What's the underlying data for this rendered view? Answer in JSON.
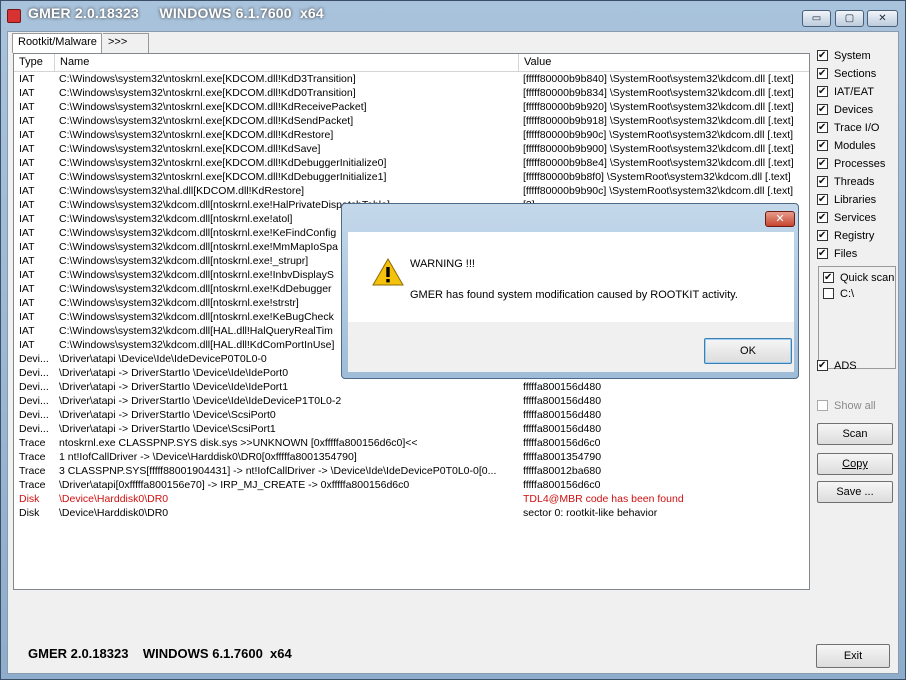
{
  "window": {
    "title": "GMER 2.0.18323     WINDOWS 6.1.7600  x64",
    "min_symbol": "▭",
    "max_symbol": "▢",
    "close_symbol": "✕"
  },
  "tabs": [
    {
      "label": "Rootkit/Malware"
    },
    {
      "label": ">>>"
    }
  ],
  "table": {
    "columns": [
      "Type",
      "Name",
      "Value"
    ],
    "rows": [
      {
        "type": "IAT",
        "name": "C:\\Windows\\system32\\ntoskrnl.exe[KDCOM.dll!KdD3Transition]",
        "value": "[fffff80000b9b840] \\SystemRoot\\system32\\kdcom.dll [.text]"
      },
      {
        "type": "IAT",
        "name": "C:\\Windows\\system32\\ntoskrnl.exe[KDCOM.dll!KdD0Transition]",
        "value": "[fffff80000b9b834] \\SystemRoot\\system32\\kdcom.dll [.text]"
      },
      {
        "type": "IAT",
        "name": "C:\\Windows\\system32\\ntoskrnl.exe[KDCOM.dll!KdReceivePacket]",
        "value": "[fffff80000b9b920] \\SystemRoot\\system32\\kdcom.dll [.text]"
      },
      {
        "type": "IAT",
        "name": "C:\\Windows\\system32\\ntoskrnl.exe[KDCOM.dll!KdSendPacket]",
        "value": "[fffff80000b9b918] \\SystemRoot\\system32\\kdcom.dll [.text]"
      },
      {
        "type": "IAT",
        "name": "C:\\Windows\\system32\\ntoskrnl.exe[KDCOM.dll!KdRestore]",
        "value": "[fffff80000b9b90c] \\SystemRoot\\system32\\kdcom.dll [.text]"
      },
      {
        "type": "IAT",
        "name": "C:\\Windows\\system32\\ntoskrnl.exe[KDCOM.dll!KdSave]",
        "value": "[fffff80000b9b900] \\SystemRoot\\system32\\kdcom.dll [.text]"
      },
      {
        "type": "IAT",
        "name": "C:\\Windows\\system32\\ntoskrnl.exe[KDCOM.dll!KdDebuggerInitialize0]",
        "value": "[fffff80000b9b8e4] \\SystemRoot\\system32\\kdcom.dll [.text]"
      },
      {
        "type": "IAT",
        "name": "C:\\Windows\\system32\\ntoskrnl.exe[KDCOM.dll!KdDebuggerInitialize1]",
        "value": "[fffff80000b9b8f0] \\SystemRoot\\system32\\kdcom.dll [.text]"
      },
      {
        "type": "IAT",
        "name": "C:\\Windows\\system32\\hal.dll[KDCOM.dll!KdRestore]",
        "value": "[fffff80000b9b90c] \\SystemRoot\\system32\\kdcom.dll [.text]"
      },
      {
        "type": "IAT",
        "name": "C:\\Windows\\system32\\kdcom.dll[ntoskrnl.exe!HalPrivateDispatchTable]",
        "value": "[3]"
      },
      {
        "type": "IAT",
        "name": "C:\\Windows\\system32\\kdcom.dll[ntoskrnl.exe!atol]",
        "value": ""
      },
      {
        "type": "IAT",
        "name": "C:\\Windows\\system32\\kdcom.dll[ntoskrnl.exe!KeFindConfig",
        "value": ""
      },
      {
        "type": "IAT",
        "name": "C:\\Windows\\system32\\kdcom.dll[ntoskrnl.exe!MmMapIoSpa",
        "value": ""
      },
      {
        "type": "IAT",
        "name": "C:\\Windows\\system32\\kdcom.dll[ntoskrnl.exe!_strupr]",
        "value": ""
      },
      {
        "type": "IAT",
        "name": "C:\\Windows\\system32\\kdcom.dll[ntoskrnl.exe!InbvDisplayS",
        "value": ""
      },
      {
        "type": "IAT",
        "name": "C:\\Windows\\system32\\kdcom.dll[ntoskrnl.exe!KdDebugger",
        "value": ""
      },
      {
        "type": "IAT",
        "name": "C:\\Windows\\system32\\kdcom.dll[ntoskrnl.exe!strstr]",
        "value": ""
      },
      {
        "type": "IAT",
        "name": "C:\\Windows\\system32\\kdcom.dll[ntoskrnl.exe!KeBugCheck",
        "value": ""
      },
      {
        "type": "IAT",
        "name": "C:\\Windows\\system32\\kdcom.dll[HAL.dll!HalQueryRealTim",
        "value": ""
      },
      {
        "type": "IAT",
        "name": "C:\\Windows\\system32\\kdcom.dll[HAL.dll!KdComPortInUse]",
        "value": ""
      },
      {
        "type": "Devi...",
        "name": "\\Driver\\atapi \\Device\\Ide\\IdeDeviceP0T0L0-0",
        "value": ""
      },
      {
        "type": "Devi...",
        "name": "\\Driver\\atapi -> DriverStartIo \\Device\\Ide\\IdePort0",
        "value": ""
      },
      {
        "type": "Devi...",
        "name": "\\Driver\\atapi -> DriverStartIo \\Device\\Ide\\IdePort1",
        "value": "fffffa800156d480"
      },
      {
        "type": "Devi...",
        "name": "\\Driver\\atapi -> DriverStartIo \\Device\\Ide\\IdeDeviceP1T0L0-2",
        "value": "fffffa800156d480"
      },
      {
        "type": "Devi...",
        "name": "\\Driver\\atapi -> DriverStartIo \\Device\\ScsiPort0",
        "value": "fffffa800156d480"
      },
      {
        "type": "Devi...",
        "name": "\\Driver\\atapi -> DriverStartIo \\Device\\ScsiPort1",
        "value": "fffffa800156d480"
      },
      {
        "type": "Trace",
        "name": "ntoskrnl.exe CLASSPNP.SYS disk.sys >>UNKNOWN [0xfffffa800156d6c0]<<",
        "value": "fffffa800156d6c0"
      },
      {
        "type": "Trace",
        "name": "1 nt!IofCallDriver -> \\Device\\Harddisk0\\DR0[0xfffffa8001354790]",
        "value": "fffffa8001354790"
      },
      {
        "type": "Trace",
        "name": "3 CLASSPNP.SYS[fffff88001904431] -> nt!IofCallDriver -> \\Device\\Ide\\IdeDeviceP0T0L0-0[0...",
        "value": "fffffa80012ba680"
      },
      {
        "type": "Trace",
        "name": "\\Driver\\atapi[0xfffffa800156e70] -> IRP_MJ_CREATE -> 0xfffffa800156d6c0",
        "value": "fffffa800156d6c0"
      },
      {
        "type": "Disk",
        "name": "\\Device\\Harddisk0\\DR0",
        "value": "TDL4@MBR code has been found",
        "alert": true
      },
      {
        "type": "Disk",
        "name": "\\Device\\Harddisk0\\DR0",
        "value": "sector 0: rootkit-like behavior"
      }
    ]
  },
  "options": {
    "items": [
      {
        "label": "System",
        "checked": true
      },
      {
        "label": "Sections",
        "checked": true
      },
      {
        "label": "IAT/EAT",
        "checked": true
      },
      {
        "label": "Devices",
        "checked": true
      },
      {
        "label": "Trace I/O",
        "checked": true
      },
      {
        "label": "Modules",
        "checked": true
      },
      {
        "label": "Processes",
        "checked": true
      },
      {
        "label": "Threads",
        "checked": true
      },
      {
        "label": "Libraries",
        "checked": true
      },
      {
        "label": "Services",
        "checked": true
      },
      {
        "label": "Registry",
        "checked": true
      },
      {
        "label": "Files",
        "checked": true
      }
    ],
    "quick_scan": "Quick scan",
    "drive_c": "C:\\",
    "ads": "ADS",
    "show_all": "Show all"
  },
  "buttons": {
    "scan": "Scan",
    "copy": "Copy",
    "save": "Save ...",
    "exit": "Exit"
  },
  "status": {
    "text": "GMER 2.0.18323    WINDOWS 6.1.7600  x64"
  },
  "dialog": {
    "title": "WARNING !!!",
    "message": "GMER has found system modification caused by ROOTKIT activity.",
    "ok": "OK",
    "close_symbol": "✕"
  }
}
